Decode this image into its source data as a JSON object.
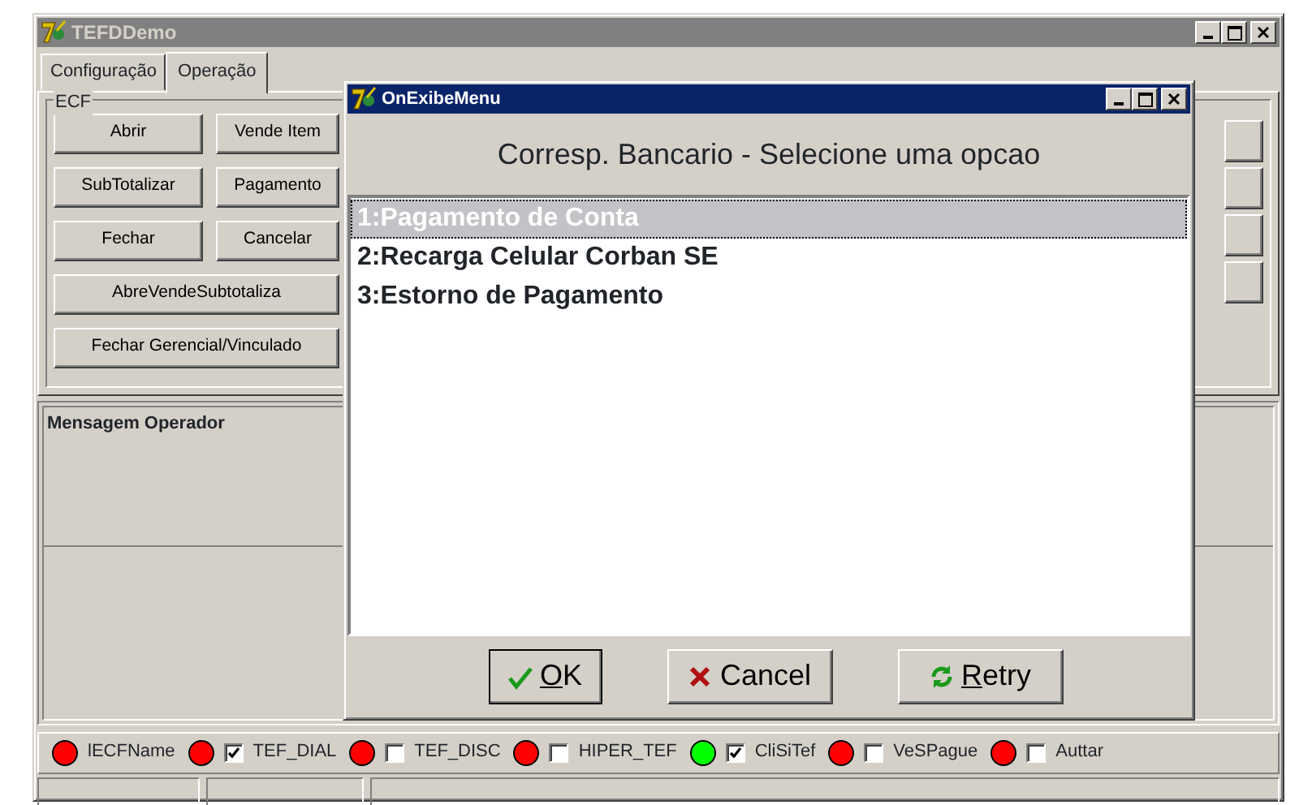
{
  "main_window": {
    "title": "TEFDDemo",
    "tabs": [
      {
        "label": "Configuração",
        "selected": false
      },
      {
        "label": "Operação",
        "selected": true
      }
    ],
    "ecf_group": {
      "title": "ECF",
      "buttons": [
        {
          "label": "Abrir",
          "wide": false
        },
        {
          "label": "Vende Item",
          "wide": false
        },
        {
          "label": "SubTotalizar",
          "wide": false
        },
        {
          "label": "Pagamento",
          "wide": false
        },
        {
          "label": "Fechar",
          "wide": false
        },
        {
          "label": "Cancelar",
          "wide": false
        },
        {
          "label": "AbreVendeSubtotaliza",
          "wide": true
        },
        {
          "label": "Fechar Gerencial/Vinculado",
          "wide": true
        }
      ]
    },
    "message_panel": {
      "title": "Mensagem Operador"
    },
    "indicators": [
      {
        "label": "lECFName",
        "color": "#ff0000",
        "kind": "label"
      },
      {
        "label": "TEF_DIAL",
        "color": "#ff0000",
        "kind": "checkbox",
        "checked": true
      },
      {
        "label": "TEF_DISC",
        "color": "#ff0000",
        "kind": "checkbox",
        "checked": false
      },
      {
        "label": "HIPER_TEF",
        "color": "#ff0000",
        "kind": "checkbox",
        "checked": false
      },
      {
        "label": "CliSiTef",
        "color": "#00ff00",
        "kind": "checkbox",
        "checked": true
      },
      {
        "label": "VeSPague",
        "color": "#ff0000",
        "kind": "checkbox",
        "checked": false
      },
      {
        "label": "Auttar",
        "color": "#ff0000",
        "kind": "checkbox",
        "checked": false
      }
    ]
  },
  "dialog": {
    "title": "OnExibeMenu",
    "heading": "Corresp. Bancario - Selecione uma opcao",
    "items": [
      {
        "label": "1:Pagamento de Conta",
        "selected": true
      },
      {
        "label": "2:Recarga Celular Corban SE",
        "selected": false
      },
      {
        "label": "3:Estorno de Pagamento",
        "selected": false
      }
    ],
    "buttons": [
      {
        "label": "OK",
        "kind": "ok"
      },
      {
        "label": "Cancel",
        "kind": "cancel"
      },
      {
        "label": "Retry",
        "kind": "retry"
      }
    ]
  }
}
